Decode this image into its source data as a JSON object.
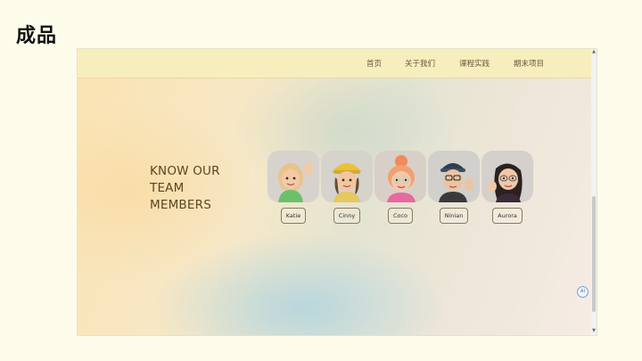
{
  "slide": {
    "title": "成品"
  },
  "nav": {
    "items": [
      "首页",
      "关于我们",
      "课程实践",
      "期末项目"
    ]
  },
  "hero": {
    "heading_lines": [
      "KNOW OUR",
      "TEAM",
      "MEMBERS"
    ]
  },
  "members": [
    {
      "name": "Katie"
    },
    {
      "name": "Cinny"
    },
    {
      "name": "Coco"
    },
    {
      "name": "Ninian"
    },
    {
      "name": "Aurora"
    }
  ],
  "widgets": {
    "ai_badge": "AI"
  },
  "colors": {
    "navbar": "#f7eebe",
    "heading": "#5a4620",
    "avatar_bg": "#d6d2cc"
  }
}
